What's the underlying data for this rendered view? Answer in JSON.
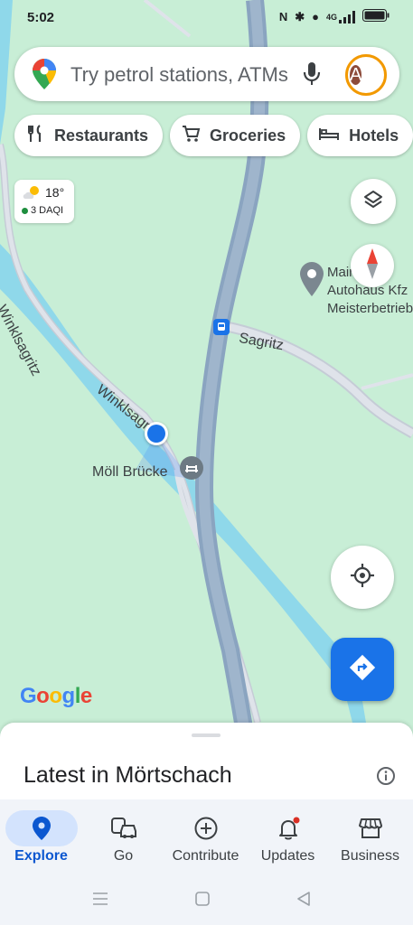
{
  "status_bar": {
    "time": "5:02",
    "network": "4G"
  },
  "search": {
    "placeholder": "Try petrol stations, ATMs",
    "avatar_letter": "A"
  },
  "chips": [
    {
      "label": "Restaurants",
      "icon": "restaurant-icon"
    },
    {
      "label": "Groceries",
      "icon": "cart-icon"
    },
    {
      "label": "Hotels",
      "icon": "bed-icon"
    }
  ],
  "weather": {
    "temp": "18°",
    "air_quality": "3 DAQI"
  },
  "map": {
    "roads": [
      "Winklsagritz",
      "Winklsagri",
      "Sagritz"
    ],
    "place_label": "Möll Brücke",
    "poi_label": "Mairhofer Autohaus Kfz Meisterbetrieb",
    "attribution": "Google"
  },
  "sheet": {
    "title": "Latest in Mörtschach"
  },
  "nav": [
    {
      "label": "Explore",
      "icon": "explore-pin-icon",
      "active": true
    },
    {
      "label": "Go",
      "icon": "commute-icon",
      "active": false
    },
    {
      "label": "Contribute",
      "icon": "add-circle-icon",
      "active": false
    },
    {
      "label": "Updates",
      "icon": "bell-icon",
      "active": false
    },
    {
      "label": "Business",
      "icon": "storefront-icon",
      "active": false
    }
  ],
  "colors": {
    "accent": "#1a73e8",
    "map_bg": "#c8eed6",
    "highway": "#8aa4c0",
    "river": "#8fd8ea"
  }
}
